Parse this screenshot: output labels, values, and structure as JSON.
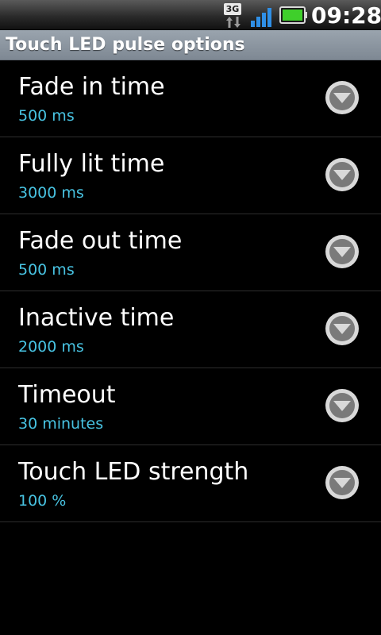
{
  "status_bar": {
    "network_type": "3G",
    "time": "09:28",
    "battery_color": "#3fcf2b",
    "icons": [
      "network-3g-icon",
      "signal-strength-icon",
      "battery-icon"
    ]
  },
  "header": {
    "title": "Touch LED pulse options"
  },
  "settings": [
    {
      "title": "Fade in time",
      "value": "500 ms"
    },
    {
      "title": "Fully lit time",
      "value": "3000 ms"
    },
    {
      "title": "Fade out time",
      "value": "500 ms"
    },
    {
      "title": "Inactive time",
      "value": "2000 ms"
    },
    {
      "title": "Timeout",
      "value": "30 minutes"
    },
    {
      "title": "Touch LED strength",
      "value": "100 %"
    }
  ],
  "colors": {
    "value_text": "#48c3e2",
    "title_bar": "#8a939d"
  }
}
